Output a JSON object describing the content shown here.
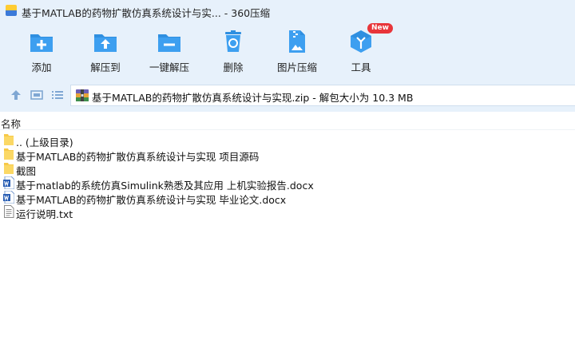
{
  "window": {
    "title": "基于MATLAB的药物扩散仿真系统设计与实... - 360压缩"
  },
  "toolbar": {
    "add_label": "添加",
    "extract_label": "解压到",
    "one_click_label": "一键解压",
    "delete_label": "删除",
    "image_compress_label": "图片压缩",
    "tools_label": "工具",
    "tools_badge": "New"
  },
  "address": {
    "path": "基于MATLAB的药物扩散仿真系统设计与实现.zip - 解包大小为 10.3 MB"
  },
  "columns": {
    "name": "名称"
  },
  "files": [
    {
      "name": ".. (上级目录)",
      "icon": "folder-icon"
    },
    {
      "name": "基于MATLAB的药物扩散仿真系统设计与实现 项目源码",
      "icon": "folder-icon"
    },
    {
      "name": "截图",
      "icon": "folder-icon"
    },
    {
      "name": "基于matlab的系统仿真Simulink熟悉及其应用 上机实验报告.docx",
      "icon": "word-doc-icon"
    },
    {
      "name": "基于MATLAB的药物扩散仿真系统设计与实现 毕业论文.docx",
      "icon": "word-doc-icon"
    },
    {
      "name": "运行说明.txt",
      "icon": "text-file-icon"
    }
  ],
  "colors": {
    "toolbar_bg": "#e7f1fb",
    "icon_blue": "#2f8fe0",
    "badge_red": "#e8353a",
    "folder_yellow": "#f7c948"
  }
}
